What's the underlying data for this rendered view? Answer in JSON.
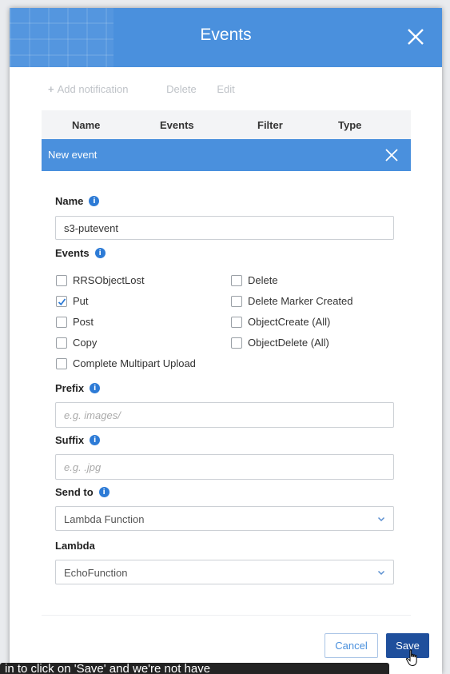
{
  "modal": {
    "title": "Events"
  },
  "toolbar": {
    "add_label": "Add notification",
    "delete_label": "Delete",
    "edit_label": "Edit"
  },
  "table": {
    "columns": [
      "Name",
      "Events",
      "Filter",
      "Type"
    ]
  },
  "event_panel": {
    "title": "New event"
  },
  "form": {
    "name": {
      "label": "Name",
      "value": "s3-putevent"
    },
    "events": {
      "label": "Events",
      "options": [
        {
          "label": "RRSObjectLost",
          "checked": false
        },
        {
          "label": "Put",
          "checked": true
        },
        {
          "label": "Post",
          "checked": false
        },
        {
          "label": "Copy",
          "checked": false
        },
        {
          "label": "Complete Multipart Upload",
          "checked": false
        },
        {
          "label": "Delete",
          "checked": false
        },
        {
          "label": "Delete Marker Created",
          "checked": false
        },
        {
          "label": "ObjectCreate (All)",
          "checked": false
        },
        {
          "label": "ObjectDelete (All)",
          "checked": false
        }
      ]
    },
    "prefix": {
      "label": "Prefix",
      "placeholder": "e.g. images/"
    },
    "suffix": {
      "label": "Suffix",
      "placeholder": "e.g. .jpg"
    },
    "send_to": {
      "label": "Send to",
      "value": "Lambda Function"
    },
    "lambda": {
      "label": "Lambda",
      "value": "EchoFunction"
    }
  },
  "footer": {
    "cancel_label": "Cancel",
    "save_label": "Save"
  },
  "caption": {
    "text": "in to click on 'Save' and we're not have"
  },
  "icons": {
    "info": "info-icon",
    "close": "close-icon",
    "chevron": "chevron-down-icon",
    "check": "check-icon",
    "cursor": "hand-pointer-icon",
    "plus": "plus-icon"
  },
  "colors": {
    "header": "#4a90dd",
    "info": "#2d7bd6",
    "save_button": "#1f4f9c",
    "caption_bar": "#232323"
  }
}
